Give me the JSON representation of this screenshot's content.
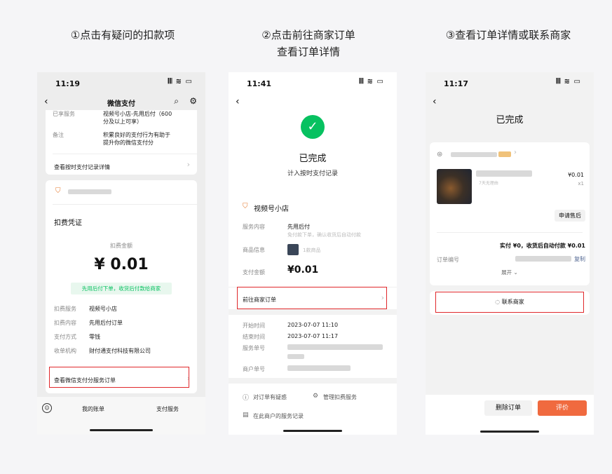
{
  "captions": {
    "step1": "①点击有疑问的扣款项",
    "step2_line1": "②点击前往商家订单",
    "step2_line2": "查看订单详情",
    "step3": "③查看订单详情或联系商家"
  },
  "phone1": {
    "time": "11:19",
    "signal": "𝄃𝄃 ≋ ▭",
    "title": "微信支付",
    "row_service_label": "已享服务",
    "row_service_value_1": "视频号小店-先用后付（600",
    "row_service_value_2": "分及以上可享）",
    "row_note_label": "备注",
    "row_note_value_1": "积累良好的支付行为有助于",
    "row_note_value_2": "提升你的微信支付分",
    "view_record_link": "查看按时支付记录详情",
    "voucher_title": "扣费凭证",
    "amount_label": "扣费金额",
    "amount": "¥ 0.01",
    "green_tag": "先用后付下单，收货后付款给商家",
    "detail_rows": [
      {
        "label": "扣费服务",
        "value": "视频号小店"
      },
      {
        "label": "扣费内容",
        "value": "先用后付订单"
      },
      {
        "label": "支付方式",
        "value": "零钱"
      },
      {
        "label": "收单机构",
        "value": "财付通支付科技有限公司"
      }
    ],
    "view_order_link": "查看微信支付分服务订单",
    "bottom_tab_bill": "我的账单",
    "bottom_tab_service": "支付服务"
  },
  "phone2": {
    "time": "11:41",
    "signal": "𝄃𝄃 ≋ ▭",
    "status_title": "已完成",
    "status_sub": "计入按时支付记录",
    "shop_name": "视频号小店",
    "svc_label": "服务内容",
    "svc_value": "先用后付",
    "svc_sub": "免付款下单，确认收货后自动付款",
    "goods_label": "商品信息",
    "goods_value": "1款商品",
    "pay_label": "支付金额",
    "pay_value": "¥0.01",
    "goto_order": "前往商家订单",
    "start_label": "开始时间",
    "start_value": "2023-07-07 11:10",
    "end_label": "结束时间",
    "end_value": "2023-07-07 11:17",
    "service_no_label": "服务单号",
    "merchant_no_label": "商户单号",
    "question": "对订单有疑惑",
    "manage": "管理扣费服务",
    "records": "在此商户的服务记录"
  },
  "phone3": {
    "time": "11:17",
    "signal": "𝄃𝄃 ≋ ▭",
    "title": "已完成",
    "price": "¥0.01",
    "qty": "x1",
    "no_reason": "7天无理由",
    "after_sale": "申请售后",
    "paid_summary": "实付 ¥0，收货后自动付款 ¥0.01",
    "order_no_label": "订单编号",
    "copy": "复制",
    "expand": "展开",
    "contact": "联系商家",
    "delete_order": "删除订单",
    "review": "评价"
  },
  "colors": {
    "accent_red": "#e0282b",
    "wechat_green": "#07c160",
    "review_orange": "#f06a3f"
  }
}
